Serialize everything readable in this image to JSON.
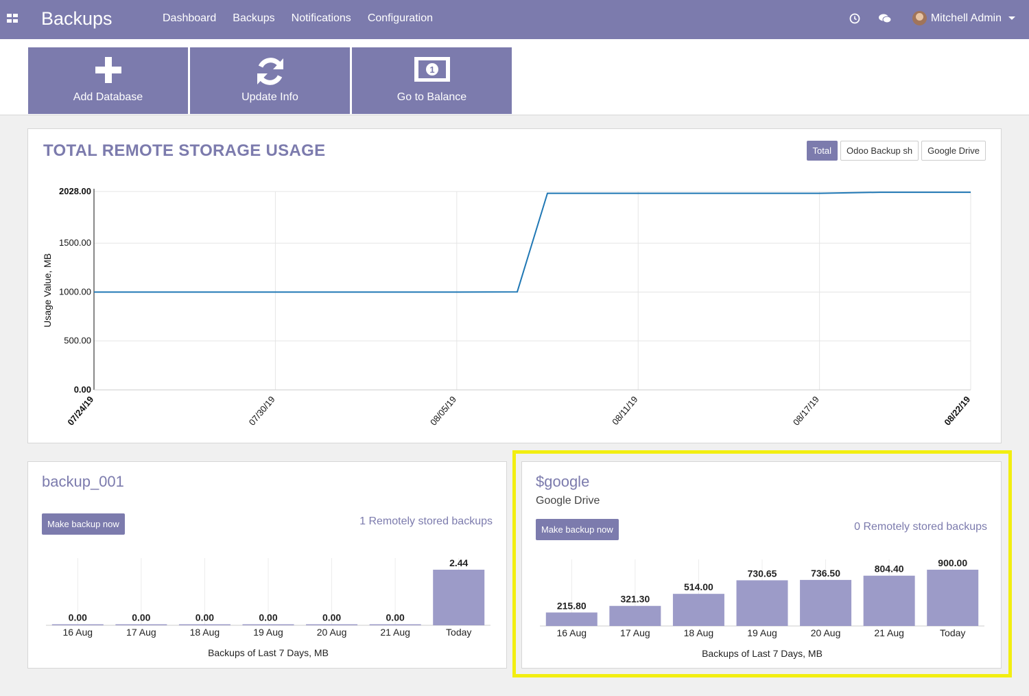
{
  "header": {
    "brand": "Backups",
    "menu": [
      "Dashboard",
      "Backups",
      "Notifications",
      "Configuration"
    ],
    "user_name": "Mitchell Admin"
  },
  "actions": [
    {
      "label": "Add Database",
      "icon": "plus-icon"
    },
    {
      "label": "Update Info",
      "icon": "refresh-icon"
    },
    {
      "label": "Go to Balance",
      "icon": "money-icon"
    }
  ],
  "storage": {
    "title": "TOTAL REMOTE STORAGE USAGE",
    "filters": [
      "Total",
      "Odoo Backup sh",
      "Google Drive"
    ],
    "active_filter": "Total"
  },
  "cards": [
    {
      "title": "backup_001",
      "subtitle": "",
      "button": "Make backup now",
      "remote_text": "1 Remotely stored backups"
    },
    {
      "title": "$google",
      "subtitle": "Google Drive",
      "button": "Make backup now",
      "remote_text": "0 Remotely stored backups"
    }
  ],
  "colors": {
    "brand": "#7c7bad",
    "bar": "#9c9bc8",
    "line": "#1f77b4",
    "highlight": "#f2ee10"
  },
  "chart_data": [
    {
      "type": "line",
      "ylabel": "Usage Value, MB",
      "ylim": [
        0,
        2028
      ],
      "yticks": [
        "0.00",
        "500.00",
        "1000.00",
        "1500.00",
        "2028.00"
      ],
      "xticks": [
        "07/24/19",
        "07/30/19",
        "08/05/19",
        "08/11/19",
        "08/17/19",
        "08/22/19"
      ],
      "x": [
        "07/24/19",
        "07/30/19",
        "08/05/19",
        "08/07/19",
        "08/08/19",
        "08/11/19",
        "08/17/19",
        "08/19/19",
        "08/22/19"
      ],
      "series": [
        {
          "values": [
            1000,
            1000,
            1000,
            1002,
            2010,
            2010,
            2010,
            2020,
            2020
          ]
        }
      ],
      "grid": true
    },
    {
      "type": "bar",
      "categories": [
        "16 Aug",
        "17 Aug",
        "18 Aug",
        "19 Aug",
        "20 Aug",
        "21 Aug",
        "Today"
      ],
      "values": [
        0.0,
        0.0,
        0.0,
        0.0,
        0.0,
        0.0,
        2.44
      ],
      "labels": [
        "0.00",
        "0.00",
        "0.00",
        "0.00",
        "0.00",
        "0.00",
        "2.44"
      ],
      "xlabel": "Backups of Last 7 Days, MB"
    },
    {
      "type": "bar",
      "categories": [
        "16 Aug",
        "17 Aug",
        "18 Aug",
        "19 Aug",
        "20 Aug",
        "21 Aug",
        "Today"
      ],
      "values": [
        215.8,
        321.3,
        514.0,
        730.65,
        736.5,
        804.4,
        900.0
      ],
      "labels": [
        "215.80",
        "321.30",
        "514.00",
        "730.65",
        "736.50",
        "804.40",
        "900.00"
      ],
      "xlabel": "Backups of Last 7 Days, MB"
    }
  ]
}
